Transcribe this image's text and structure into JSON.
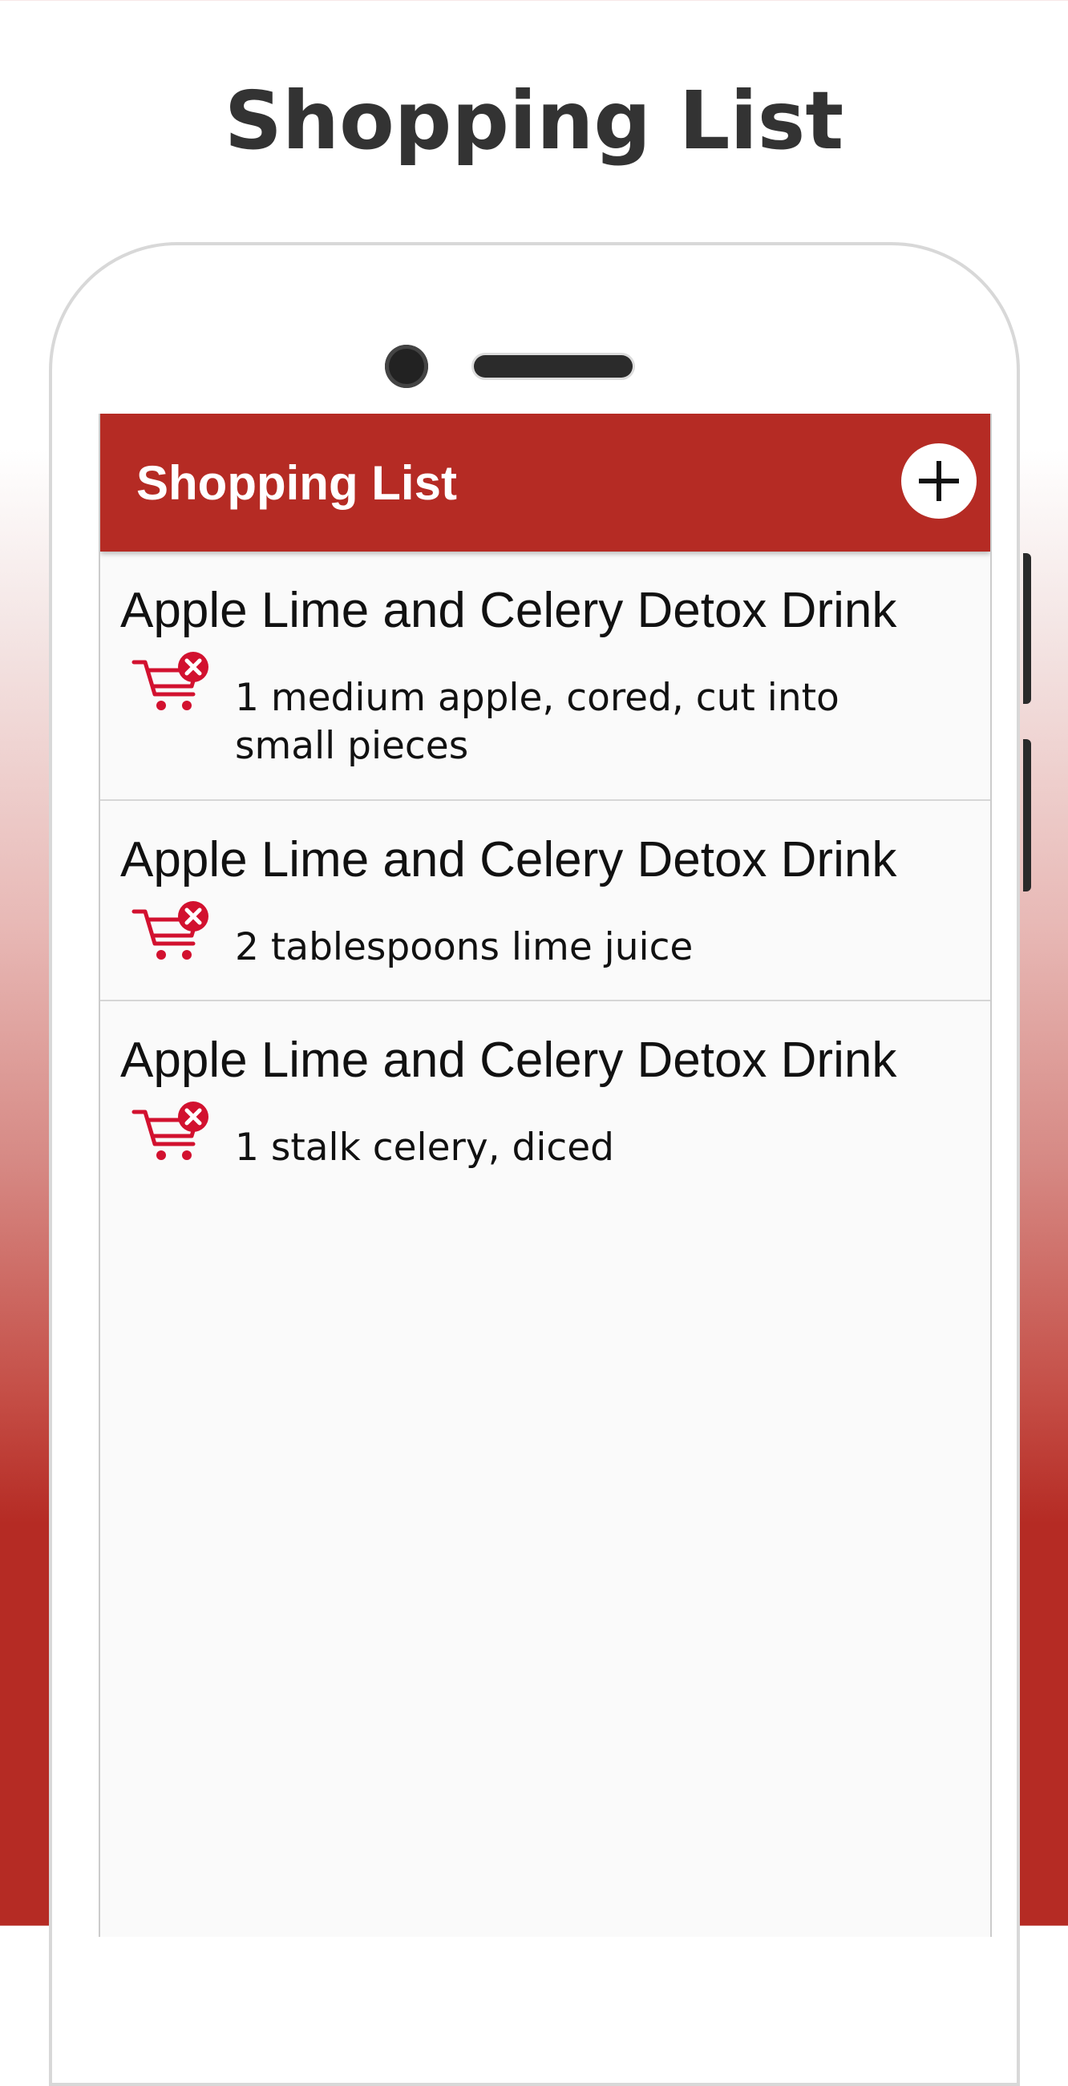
{
  "promo": {
    "title": "Shopping List"
  },
  "app_bar": {
    "title": "Shopping List",
    "add_icon": "plus-icon",
    "background_color": "#b52b24"
  },
  "items": [
    {
      "title": "Apple Lime and Celery Detox Drink",
      "detail": "1 medium apple, cored, cut into small pieces",
      "icon": "cart-remove-icon"
    },
    {
      "title": "Apple Lime and Celery Detox Drink",
      "detail": "2 tablespoons lime juice",
      "icon": "cart-remove-icon"
    },
    {
      "title": "Apple Lime and Celery Detox Drink",
      "detail": "1 stalk celery, diced",
      "icon": "cart-remove-icon"
    }
  ],
  "colors": {
    "accent": "#b52b24",
    "icon_red": "#d2112f"
  }
}
